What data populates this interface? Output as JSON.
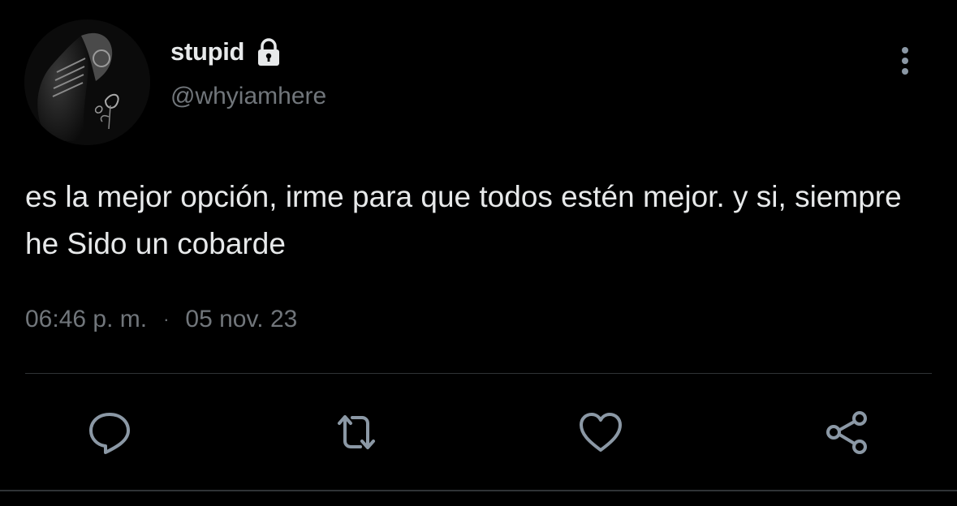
{
  "tweet": {
    "display_name": "stupid",
    "handle": "@whyiamhere",
    "text": "es la mejor opción, irme para que todos estén mejor. y si, siempre he Sido un cobarde",
    "time": "06:46 p. m.",
    "separator": "·",
    "date": "05 nov. 23"
  },
  "icons": {
    "lock": "lock-icon",
    "more": "vertical-dots-icon",
    "reply": "speech-bubble-icon",
    "retweet": "retweet-arrows-icon",
    "like": "heart-icon",
    "share": "share-nodes-icon"
  },
  "colors": {
    "background": "#000000",
    "primary_text": "#e7e9ea",
    "secondary_text": "#71767b",
    "icon": "#8b98a5",
    "divider": "#2f3336"
  }
}
